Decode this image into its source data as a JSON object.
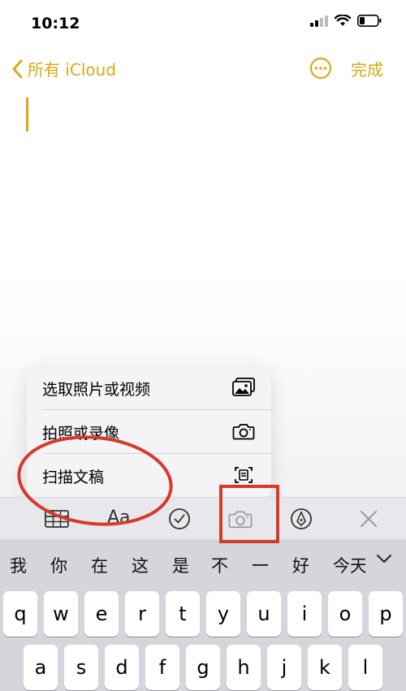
{
  "status": {
    "time": "10:12"
  },
  "nav": {
    "back_label": "所有 iCloud",
    "done_label": "完成"
  },
  "menu": {
    "items": [
      {
        "label": "选取照片或视频",
        "icon": "photo-library-icon"
      },
      {
        "label": "拍照或录像",
        "icon": "camera-icon"
      },
      {
        "label": "扫描文稿",
        "icon": "scan-document-icon"
      }
    ]
  },
  "toolbar": {
    "format_label": "Aa",
    "accent_color": "#d9a915"
  },
  "candidates": [
    "我",
    "你",
    "在",
    "这",
    "是",
    "不",
    "一",
    "好",
    "今天"
  ],
  "keyboard": {
    "row1": [
      "q",
      "w",
      "e",
      "r",
      "t",
      "y",
      "u",
      "i",
      "o",
      "p"
    ],
    "row2": [
      "a",
      "s",
      "d",
      "f",
      "g",
      "h",
      "j",
      "k",
      "l"
    ]
  },
  "annotation_color": "#d63a2a"
}
